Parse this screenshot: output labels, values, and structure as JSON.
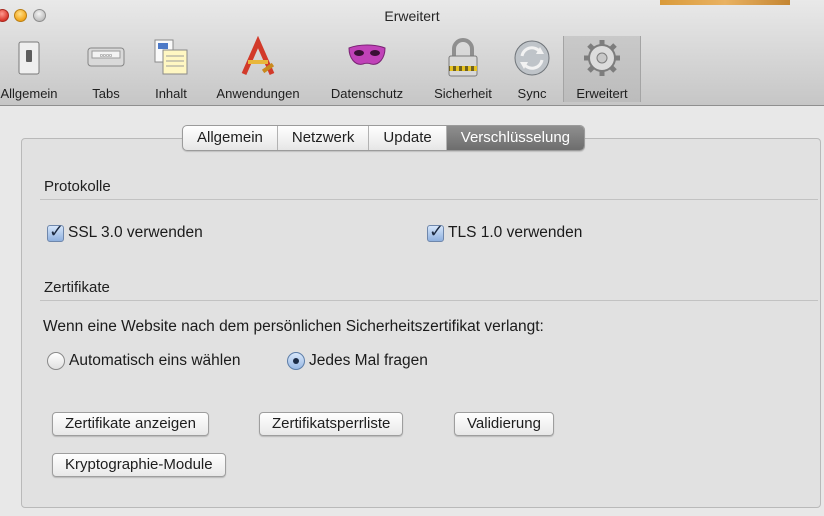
{
  "window": {
    "title": "Erweitert"
  },
  "toolbar": {
    "items": [
      {
        "label": "Allgemein",
        "icon": "switch-icon"
      },
      {
        "label": "Tabs",
        "icon": "tabs-icon"
      },
      {
        "label": "Inhalt",
        "icon": "content-icon"
      },
      {
        "label": "Anwendungen",
        "icon": "applications-icon"
      },
      {
        "label": "Datenschutz",
        "icon": "mask-icon"
      },
      {
        "label": "Sicherheit",
        "icon": "padlock-icon"
      },
      {
        "label": "Sync",
        "icon": "sync-icon"
      },
      {
        "label": "Erweitert",
        "icon": "gear-icon"
      }
    ],
    "selected": "Erweitert"
  },
  "tabs": [
    {
      "label": "Allgemein"
    },
    {
      "label": "Netzwerk"
    },
    {
      "label": "Update"
    },
    {
      "label": "Verschlüsselung"
    }
  ],
  "active_tab": "Verschlüsselung",
  "protocols": {
    "title": "Protokolle",
    "ssl": {
      "label": "SSL 3.0 verwenden",
      "checked": true
    },
    "tls": {
      "label": "TLS 1.0 verwenden",
      "checked": true
    }
  },
  "certificates": {
    "title": "Zertifikate",
    "prompt": "Wenn eine Website nach dem persönlichen Sicherheitszertifikat verlangt:",
    "options": [
      {
        "label": "Automatisch eins wählen",
        "selected": false
      },
      {
        "label": "Jedes Mal fragen",
        "selected": true
      }
    ],
    "buttons": {
      "view": "Zertifikate anzeigen",
      "revocation": "Zertifikatsperrliste",
      "validation": "Validierung",
      "crypto": "Kryptographie-Module"
    }
  }
}
